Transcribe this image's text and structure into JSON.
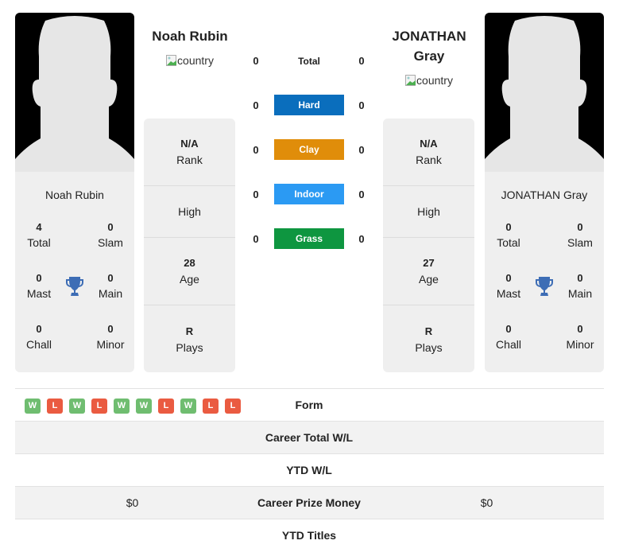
{
  "colors": {
    "hard": "#0a6ebd",
    "clay": "#e08d0a",
    "indoor": "#2b9af3",
    "grass": "#0e9640",
    "win": "#6fbd70",
    "loss": "#ea5b41",
    "trophy": "#3d6db5"
  },
  "player1": {
    "name": "Noah Rubin",
    "header_name": "Noah Rubin",
    "country_alt": "country",
    "titles": {
      "total": {
        "value": "4",
        "label": "Total"
      },
      "slam": {
        "value": "0",
        "label": "Slam"
      },
      "mast": {
        "value": "0",
        "label": "Mast"
      },
      "main": {
        "value": "0",
        "label": "Main"
      },
      "chall": {
        "value": "0",
        "label": "Chall"
      },
      "minor": {
        "value": "0",
        "label": "Minor"
      }
    },
    "info": {
      "rank": {
        "value": "N/A",
        "label": "Rank"
      },
      "high": {
        "label": "High"
      },
      "age": {
        "value": "28",
        "label": "Age"
      },
      "plays": {
        "value": "R",
        "label": "Plays"
      }
    }
  },
  "player2": {
    "name": "JONATHAN Gray",
    "header_name_line1": "JONATHAN",
    "header_name_line2": "Gray",
    "country_alt": "country",
    "titles": {
      "total": {
        "value": "0",
        "label": "Total"
      },
      "slam": {
        "value": "0",
        "label": "Slam"
      },
      "mast": {
        "value": "0",
        "label": "Mast"
      },
      "main": {
        "value": "0",
        "label": "Main"
      },
      "chall": {
        "value": "0",
        "label": "Chall"
      },
      "minor": {
        "value": "0",
        "label": "Minor"
      }
    },
    "info": {
      "rank": {
        "value": "N/A",
        "label": "Rank"
      },
      "high": {
        "label": "High"
      },
      "age": {
        "value": "27",
        "label": "Age"
      },
      "plays": {
        "value": "R",
        "label": "Plays"
      }
    }
  },
  "h2h": {
    "total": {
      "label": "Total",
      "p1": "0",
      "p2": "0"
    },
    "hard": {
      "label": "Hard",
      "p1": "0",
      "p2": "0"
    },
    "clay": {
      "label": "Clay",
      "p1": "0",
      "p2": "0"
    },
    "indoor": {
      "label": "Indoor",
      "p1": "0",
      "p2": "0"
    },
    "grass": {
      "label": "Grass",
      "p1": "0",
      "p2": "0"
    }
  },
  "stats": {
    "form": {
      "label": "Form",
      "p1": [
        "W",
        "L",
        "W",
        "L",
        "W",
        "W",
        "L",
        "W",
        "L",
        "L"
      ]
    },
    "career_wl": {
      "label": "Career Total W/L",
      "p1": "",
      "p2": ""
    },
    "ytd_wl": {
      "label": "YTD W/L",
      "p1": "",
      "p2": ""
    },
    "prize": {
      "label": "Career Prize Money",
      "p1": "$0",
      "p2": "$0"
    },
    "ytd_titles": {
      "label": "YTD Titles",
      "p1": "",
      "p2": ""
    }
  }
}
